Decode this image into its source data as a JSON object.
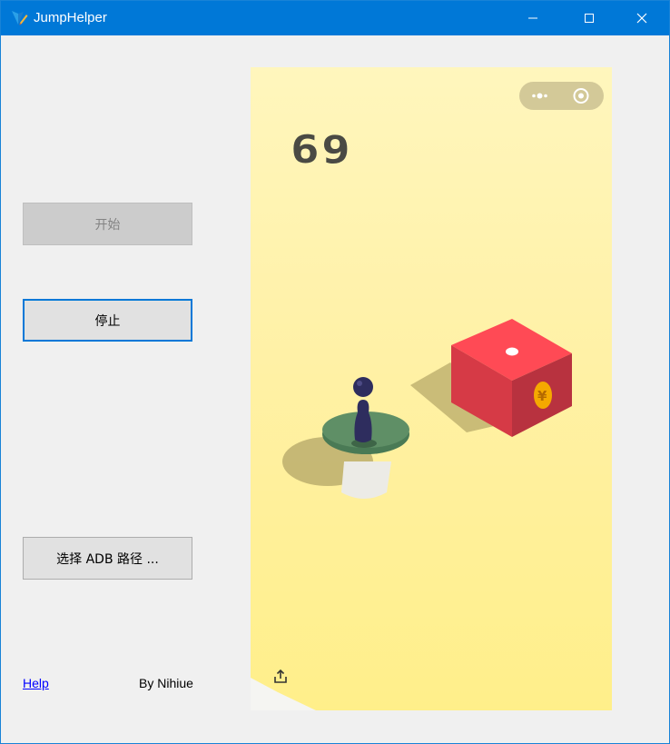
{
  "window": {
    "title": "JumpHelper",
    "controls": {
      "minimize": "minimize",
      "maximize": "maximize",
      "close": "close"
    }
  },
  "buttons": {
    "start_label": "开始",
    "stop_label": "停止",
    "adb_label": "选择 ADB 路径 ..."
  },
  "footer": {
    "help_label": "Help",
    "author_label": "By Nihiue"
  },
  "game": {
    "score": "69",
    "capsule_icons": [
      "more-icon",
      "target-close-icon"
    ],
    "share_icon": "share-icon",
    "colors": {
      "background_top": "#fff6bd",
      "background_bottom": "#ffef8a",
      "target_box": "#ff4a55",
      "coin": "#f5a900",
      "platform_top": "#5a8a63",
      "piece": "#2e2d5e"
    },
    "coin_symbol": "¥"
  }
}
